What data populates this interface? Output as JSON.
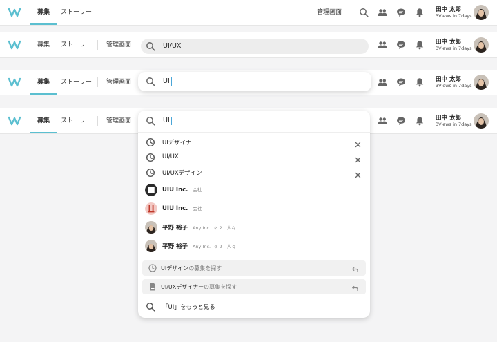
{
  "colors": {
    "accent": "#5bbfd0",
    "logo": "#5bbfd0",
    "background": "#f4f4f5"
  },
  "nav": {
    "recruit": "募集",
    "stories": "ストーリー",
    "admin": "管理画面"
  },
  "user": {
    "name": "田中 太郎",
    "views": "3Views in 7days"
  },
  "icons": [
    "search-icon",
    "people-icon",
    "chat-icon",
    "bell-icon",
    "clock-icon",
    "close-icon",
    "document-icon",
    "return-icon"
  ],
  "search": {
    "value_full": "UI/UX",
    "value_short": "UI"
  },
  "dropdown": {
    "history": [
      {
        "label": "UIデザイナー"
      },
      {
        "label": "UI/UX"
      },
      {
        "label": "UI/UXデザイン"
      }
    ],
    "companies": [
      {
        "name": "UIU Inc.",
        "type": "会社"
      },
      {
        "name": "UIU Inc.",
        "type": "会社"
      }
    ],
    "people": [
      {
        "name": "平野 裕子",
        "company": "Any Inc.",
        "mutual": "2",
        "mutual_unit": "人々"
      },
      {
        "name": "平野 裕子",
        "company": "Any Inc.",
        "mutual": "2",
        "mutual_unit": "人々"
      }
    ],
    "suggestions": [
      {
        "keyword": "UIデザイン",
        "suffix": "の募集を探す"
      },
      {
        "keyword": "UI/UXデザイナー",
        "suffix": "の募集を探す"
      }
    ],
    "see_more": "「UI」をもっと見る"
  }
}
